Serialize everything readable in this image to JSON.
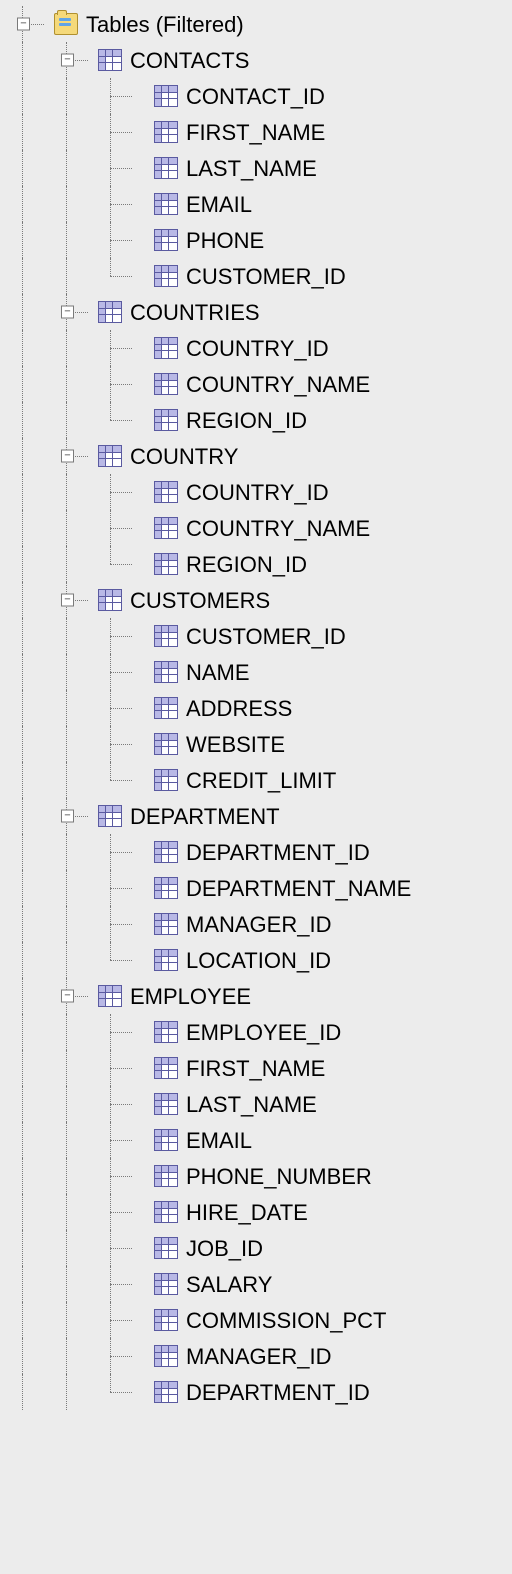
{
  "root": {
    "label": "Tables (Filtered)",
    "tables": [
      {
        "name": "CONTACTS",
        "columns": [
          "CONTACT_ID",
          "FIRST_NAME",
          "LAST_NAME",
          "EMAIL",
          "PHONE",
          "CUSTOMER_ID"
        ]
      },
      {
        "name": "COUNTRIES",
        "columns": [
          "COUNTRY_ID",
          "COUNTRY_NAME",
          "REGION_ID"
        ]
      },
      {
        "name": "COUNTRY",
        "columns": [
          "COUNTRY_ID",
          "COUNTRY_NAME",
          "REGION_ID"
        ]
      },
      {
        "name": "CUSTOMERS",
        "columns": [
          "CUSTOMER_ID",
          "NAME",
          "ADDRESS",
          "WEBSITE",
          "CREDIT_LIMIT"
        ]
      },
      {
        "name": "DEPARTMENT",
        "columns": [
          "DEPARTMENT_ID",
          "DEPARTMENT_NAME",
          "MANAGER_ID",
          "LOCATION_ID"
        ]
      },
      {
        "name": "EMPLOYEE",
        "columns": [
          "EMPLOYEE_ID",
          "FIRST_NAME",
          "LAST_NAME",
          "EMAIL",
          "PHONE_NUMBER",
          "HIRE_DATE",
          "JOB_ID",
          "SALARY",
          "COMMISSION_PCT",
          "MANAGER_ID",
          "DEPARTMENT_ID"
        ]
      }
    ]
  }
}
